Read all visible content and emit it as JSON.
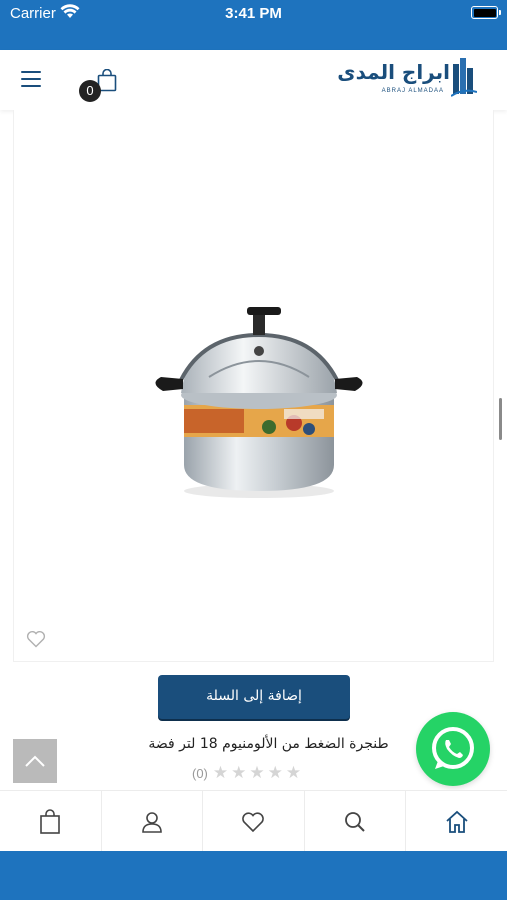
{
  "status_bar": {
    "carrier": "Carrier",
    "time": "3:41 PM"
  },
  "header": {
    "cart_count": "0",
    "logo_text_ar": "ابراج المدى",
    "logo_text_en": "ABRAJ ALMADAA"
  },
  "product": {
    "title": "طنجرة الضغط من الألومنيوم 18 لتر فضة",
    "add_to_cart_label": "إضافة إلى السلة",
    "rating_count": "(0)",
    "rating_value": 0,
    "rating_max": 5,
    "image_icon": "pressure-cooker-image"
  },
  "bottom_nav": {
    "items": [
      "cart-icon",
      "user-icon",
      "heart-icon",
      "search-icon",
      "home-icon"
    ]
  },
  "colors": {
    "brand_blue": "#1e73be",
    "dark_blue": "#1a4e7c",
    "whatsapp_green": "#25d366",
    "star_empty": "#d5d5d5"
  }
}
